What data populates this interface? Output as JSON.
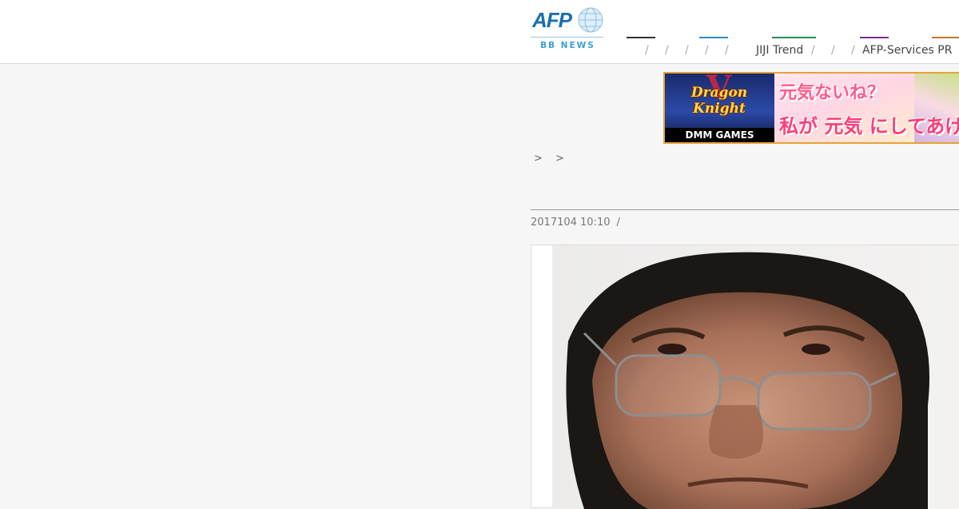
{
  "header": {
    "logo": {
      "brand": "AFP",
      "subbrand": "BB NEWS"
    },
    "nav": {
      "separator": "/",
      "jiji_label": "JIJI Trend",
      "afp_services_label": "AFP-Services PR",
      "accent_colors": [
        "#333333",
        "#2a8fc1",
        "#2e8b57",
        "#7b2d8b",
        "#c8742a"
      ]
    }
  },
  "banner": {
    "game_title": "Dragon Knight",
    "game_numeral": "V",
    "publisher": "DMM GAMES",
    "tagline_1": "元気ないね？",
    "tagline_2": "私が 元気 にしてあげ"
  },
  "article": {
    "breadcrumb": "> >",
    "title": "",
    "date": "2017104 10:10",
    "date_separator": "/"
  },
  "photo": {
    "subject": "portrait of a man wearing glasses"
  }
}
